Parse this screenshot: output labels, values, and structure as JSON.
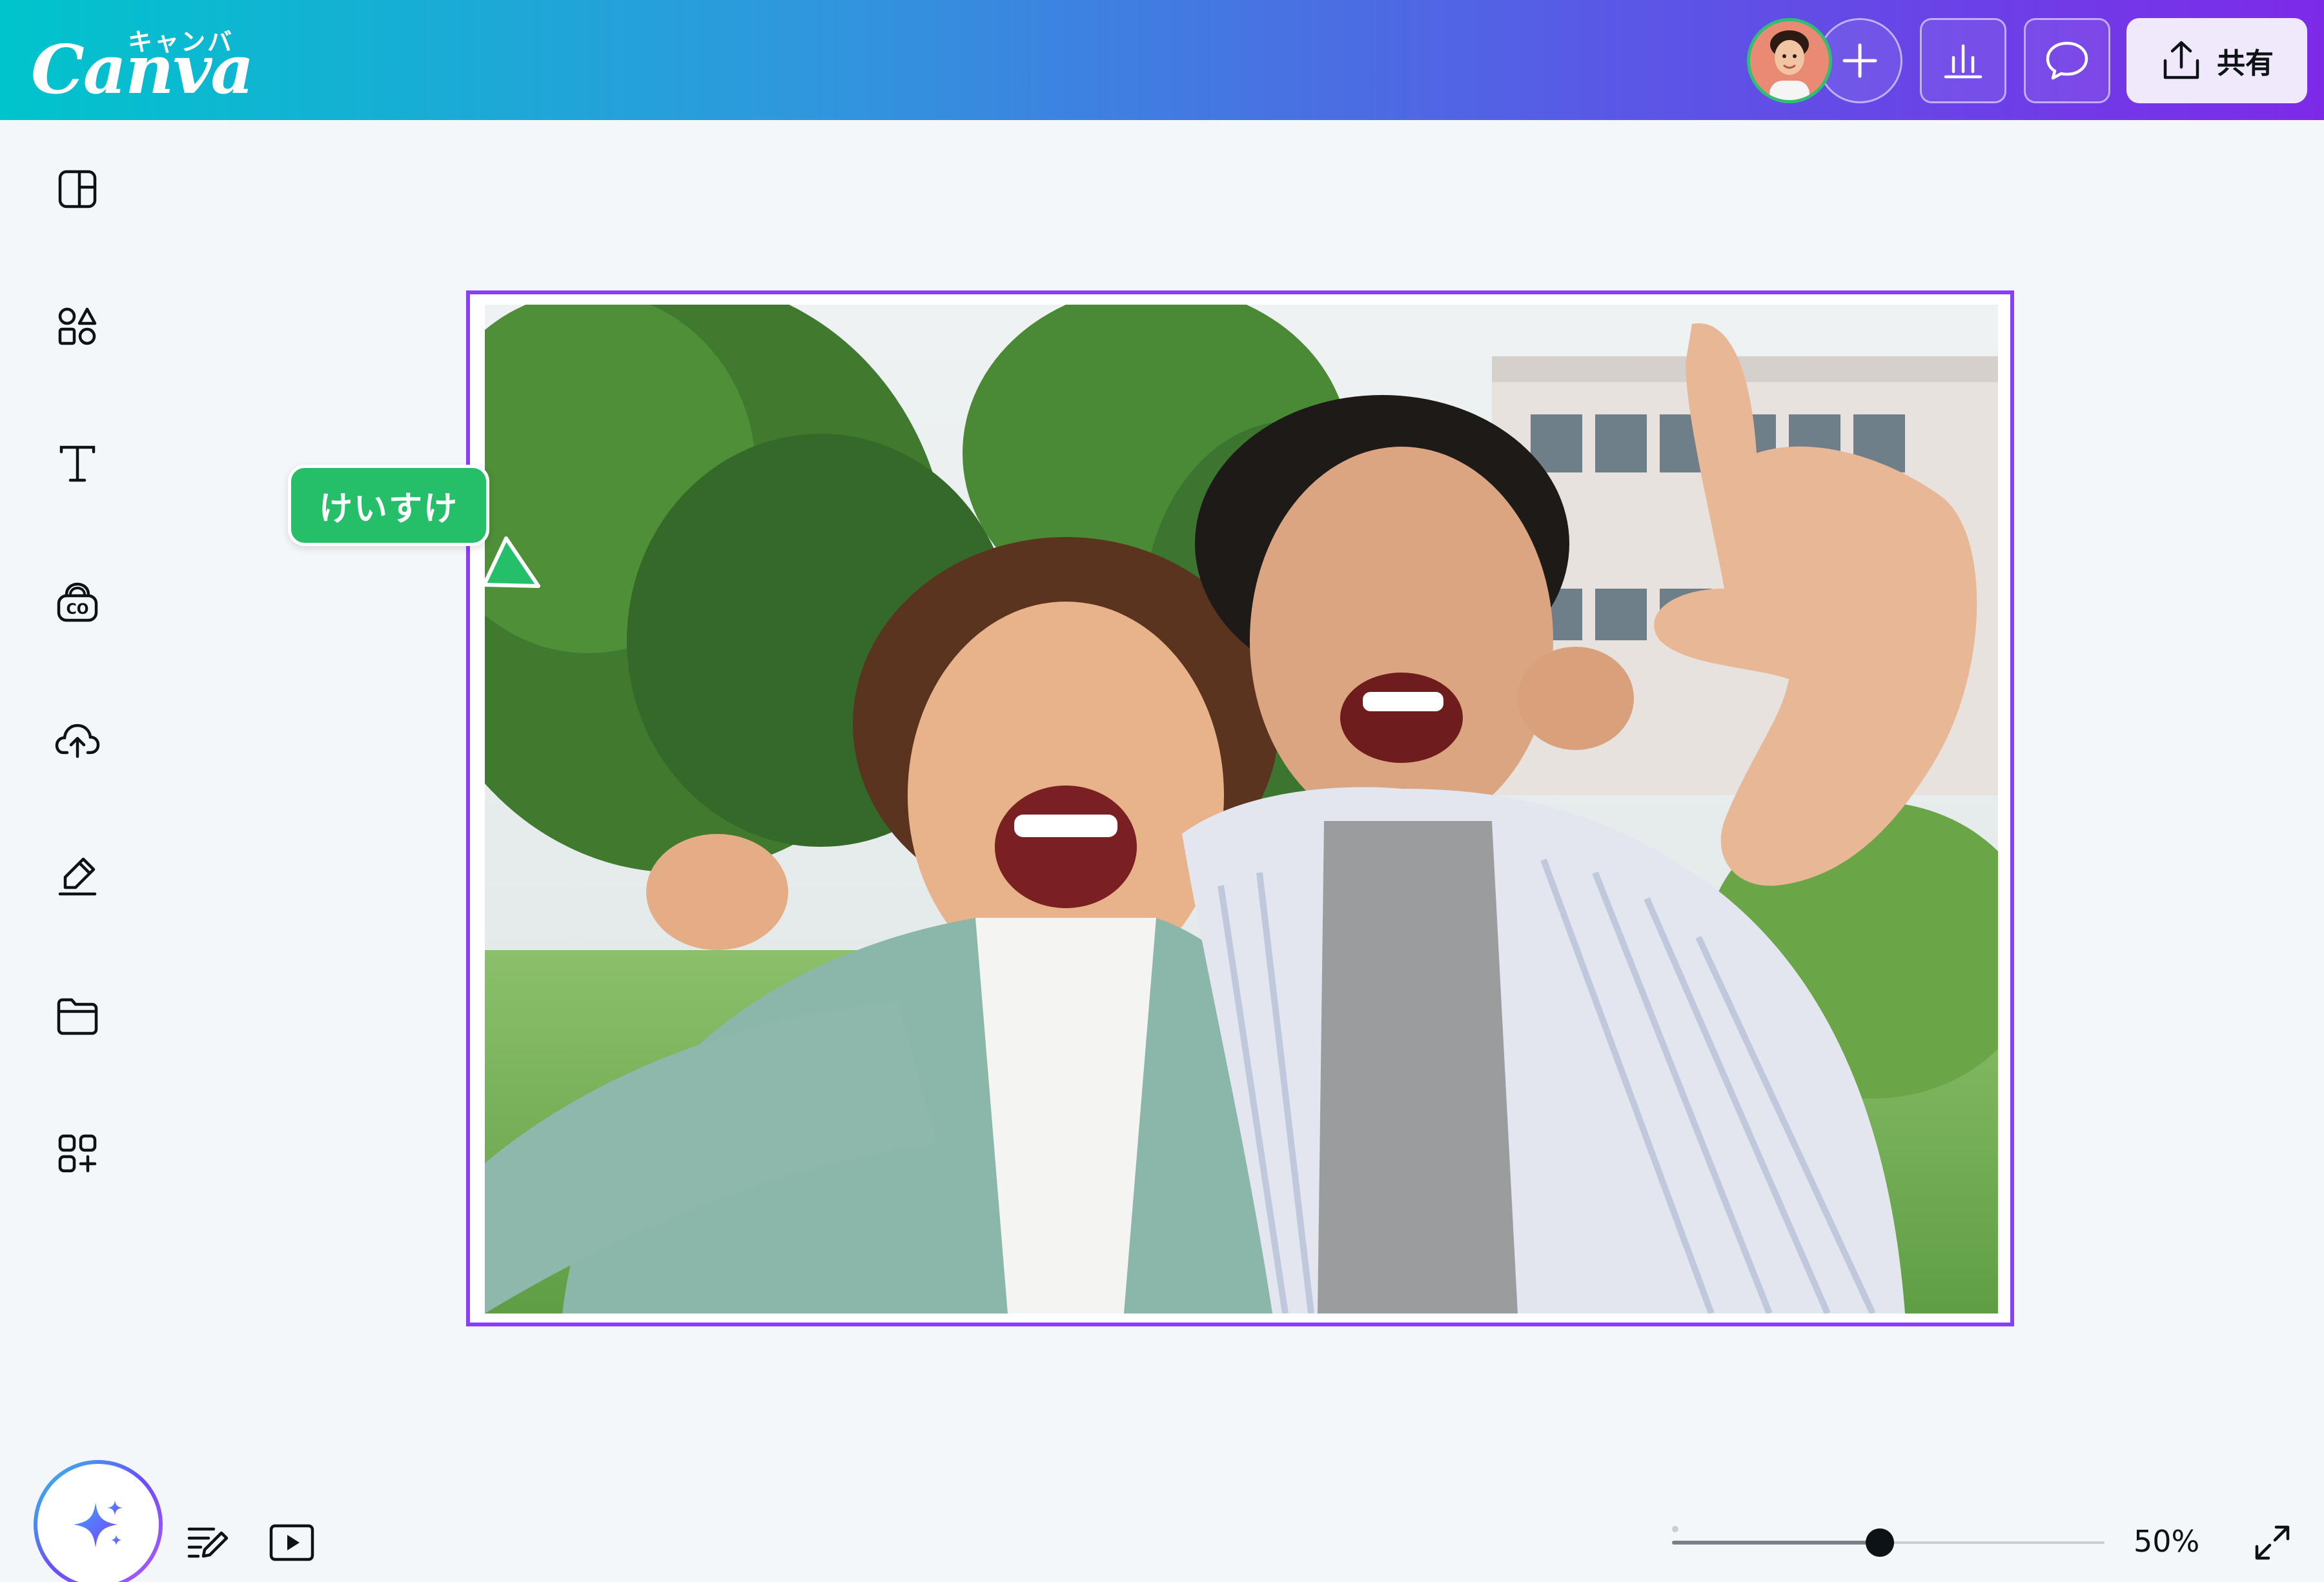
{
  "app": {
    "logo_kana": "キャンバ",
    "logo_word": "Canva"
  },
  "header": {
    "share_label": "共有"
  },
  "colors": {
    "accent": "#8b3dff",
    "collaborator": "#25bf6a",
    "header_start": "#00c4cc",
    "header_end": "#7d2ae8"
  },
  "icons": {
    "rail": [
      "design-panel-icon",
      "elements-icon",
      "text-icon",
      "brand-icon",
      "uploads-icon",
      "draw-icon",
      "projects-icon",
      "apps-icon"
    ],
    "header": [
      "avatar",
      "plus-icon",
      "insights-icon",
      "comment-icon",
      "share-icon"
    ],
    "bottom": [
      "magic-sparkle-icon",
      "notes-icon",
      "present-icon",
      "fullscreen-icon"
    ]
  },
  "canvas": {
    "collaborator_name": "けいすけ"
  },
  "zoom": {
    "value_label": "50%",
    "level": 0.48
  }
}
